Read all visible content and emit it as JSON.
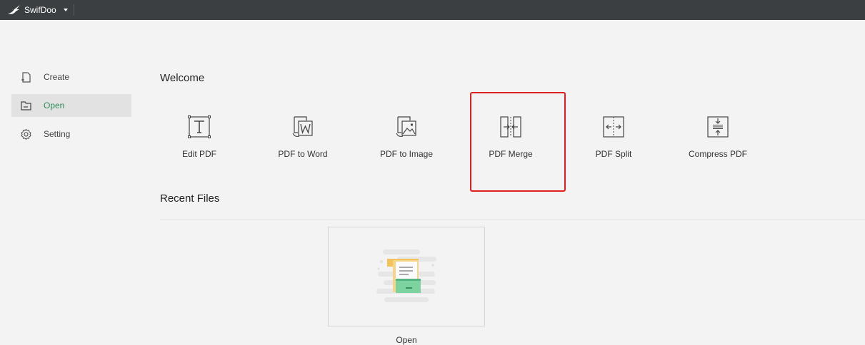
{
  "app": {
    "title": "SwifDoo"
  },
  "sidebar": {
    "items": [
      {
        "label": "Create",
        "icon": "create-file-icon"
      },
      {
        "label": "Open",
        "icon": "folder-icon",
        "active": true
      },
      {
        "label": "Setting",
        "icon": "gear-icon"
      }
    ]
  },
  "main": {
    "welcome_heading": "Welcome",
    "tools": [
      {
        "label": "Edit PDF",
        "icon": "text-edit-icon"
      },
      {
        "label": "PDF to Word",
        "icon": "word-icon"
      },
      {
        "label": "PDF to Image",
        "icon": "image-icon"
      },
      {
        "label": "PDF Merge",
        "icon": "merge-icon"
      },
      {
        "label": "PDF Split",
        "icon": "split-icon"
      },
      {
        "label": "Compress PDF",
        "icon": "compress-icon"
      }
    ],
    "recent_heading": "Recent Files",
    "open_card_label": "Open"
  },
  "colors": {
    "titlebar": "#3c3f41",
    "active_text": "#2e8b57",
    "highlight": "#e02020"
  }
}
